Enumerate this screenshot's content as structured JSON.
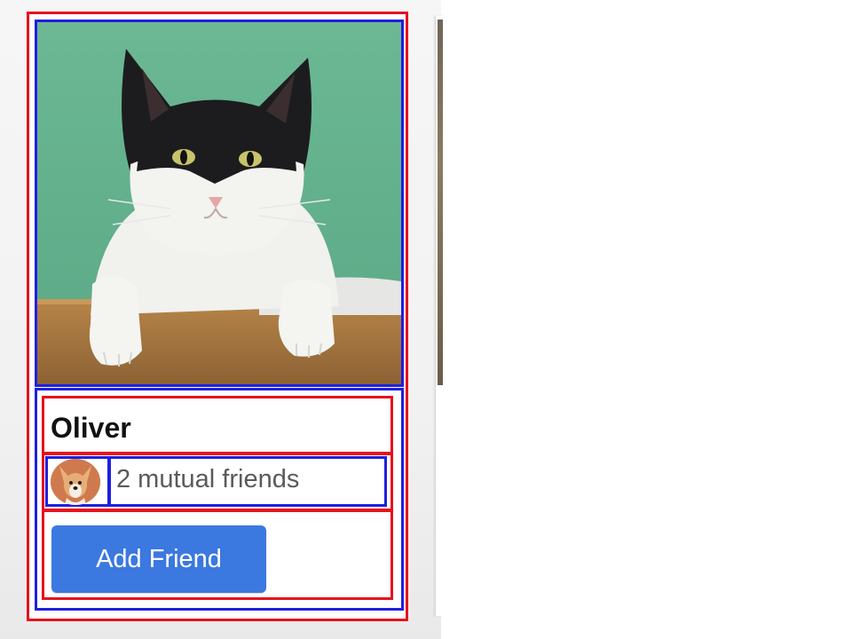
{
  "card": {
    "name": "Oliver",
    "photo_subject": "cat-photo",
    "mutual_friends_text": "2 mutual friends",
    "avatar_subject": "dog-avatar",
    "add_friend_label": "Add Friend"
  },
  "colors": {
    "button": "#3b78e0",
    "debug_outer": "#e8101c",
    "debug_inner": "#1f1fe0",
    "photo_background": "#6fb896"
  },
  "icons": {
    "avatar": "dog-avatar-icon"
  }
}
